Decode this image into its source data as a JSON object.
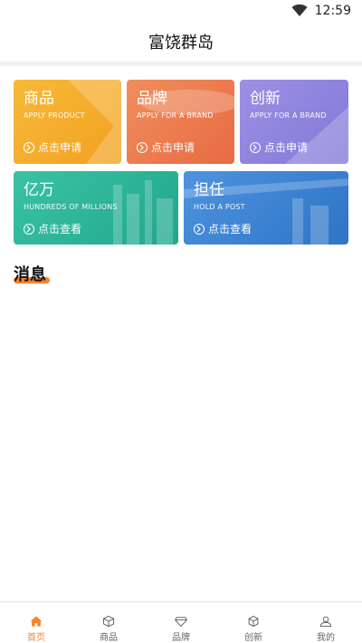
{
  "status": {
    "time": "12:59"
  },
  "header": {
    "title": "富饶群岛"
  },
  "cards": [
    {
      "title": "商品",
      "subtitle": "APPLY PRODUCT",
      "action": "点击申请"
    },
    {
      "title": "品牌",
      "subtitle": "APPLY FOR A BRAND",
      "action": "点击申请"
    },
    {
      "title": "创新",
      "subtitle": "APPLY FOR A BRAND",
      "action": "点击申请"
    },
    {
      "title": "亿万",
      "subtitle": "HUNDREDS OF MILLIONS",
      "action": "点击查看"
    },
    {
      "title": "担任",
      "subtitle": "HOLD A POST",
      "action": "点击查看"
    }
  ],
  "section": {
    "title": "消息"
  },
  "nav": [
    {
      "label": "首页",
      "icon": "home-icon"
    },
    {
      "label": "商品",
      "icon": "box-icon"
    },
    {
      "label": "品牌",
      "icon": "diamond-icon"
    },
    {
      "label": "创新",
      "icon": "cube-icon"
    },
    {
      "label": "我的",
      "icon": "user-icon"
    }
  ],
  "colors": {
    "accent": "#f7832b"
  }
}
